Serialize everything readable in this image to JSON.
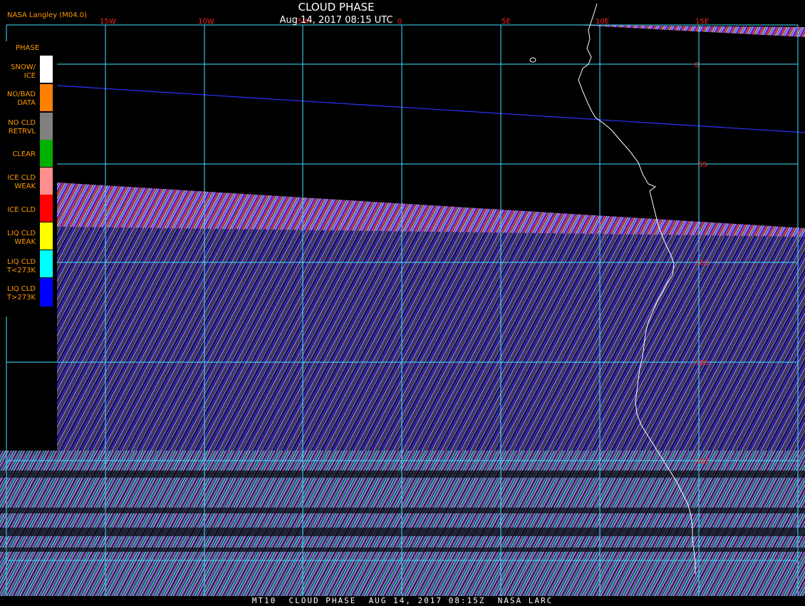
{
  "header": {
    "title": "CLOUD PHASE",
    "subtitle": "Aug 14, 2017 08:15 UTC",
    "source": "NASA Langley (M04.0)"
  },
  "footer": {
    "text": "MT10  CLOUD PHASE  AUG 14, 2017 08:15Z  NASA LARC"
  },
  "legend": {
    "title": "PHASE",
    "items": [
      {
        "label": "SNOW/\nICE",
        "color": "#ffffff"
      },
      {
        "label": "NO/BAD\nDATA",
        "color": "#ff8000"
      },
      {
        "label": "NO CLD\nRETRVL",
        "color": "#808080"
      },
      {
        "label": "CLEAR",
        "color": "#00b000"
      },
      {
        "label": "ICE CLD\nWEAK",
        "color": "#ff8f8f"
      },
      {
        "label": "ICE CLD",
        "color": "#ff0000"
      },
      {
        "label": "LIQ CLD\nWEAK",
        "color": "#ffff00"
      },
      {
        "label": "LIQ CLD\nT<273K",
        "color": "#00ffff"
      },
      {
        "label": "LIQ CLD\nT>273K",
        "color": "#0000ff"
      }
    ]
  },
  "grid": {
    "longitude_labels": [
      "15W",
      "10W",
      "5W",
      "0",
      "5E",
      "10E",
      "15E"
    ],
    "latitude_labels": [
      "0",
      "5S",
      "10S",
      "15S",
      "20S"
    ],
    "grid_color": "#40e0ff",
    "label_color": "#ff2020"
  }
}
